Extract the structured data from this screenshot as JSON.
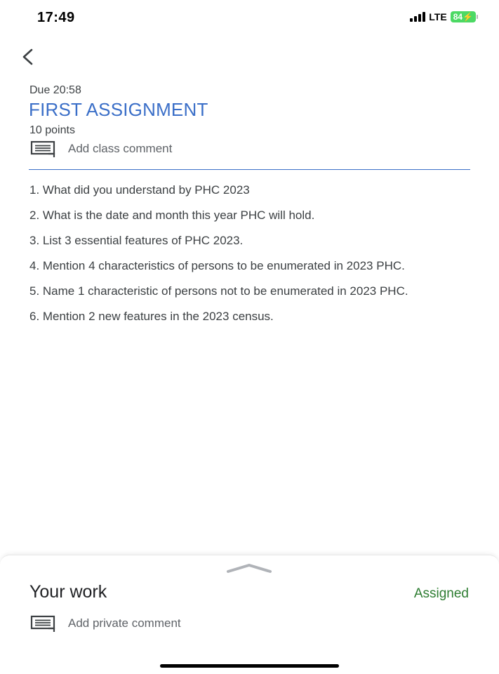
{
  "status_bar": {
    "time": "17:49",
    "network": "LTE",
    "battery": "84"
  },
  "assignment": {
    "due": "Due 20:58",
    "title": "FIRST ASSIGNMENT",
    "points": "10 points",
    "class_comment_label": "Add class comment",
    "questions": [
      "1. What did you understand by PHC 2023",
      "2. What is the date and month this year PHC will hold.",
      "3. List 3 essential features of PHC 2023.",
      "4. Mention 4 characteristics of persons to be enumerated in 2023 PHC.",
      "5. Name 1 characteristic of persons not to be enumerated in 2023 PHC.",
      "6. Mention 2 new features in the 2023 census."
    ]
  },
  "your_work": {
    "heading": "Your work",
    "status": "Assigned",
    "private_comment_label": "Add private comment"
  },
  "colors": {
    "accent_blue": "#3b6fc8",
    "assigned_green": "#2e7d32",
    "battery_green": "#4cd964"
  },
  "icons": {
    "back": "chevron-left-icon",
    "comment": "comment-icon",
    "sheet_handle": "chevron-up-icon"
  }
}
